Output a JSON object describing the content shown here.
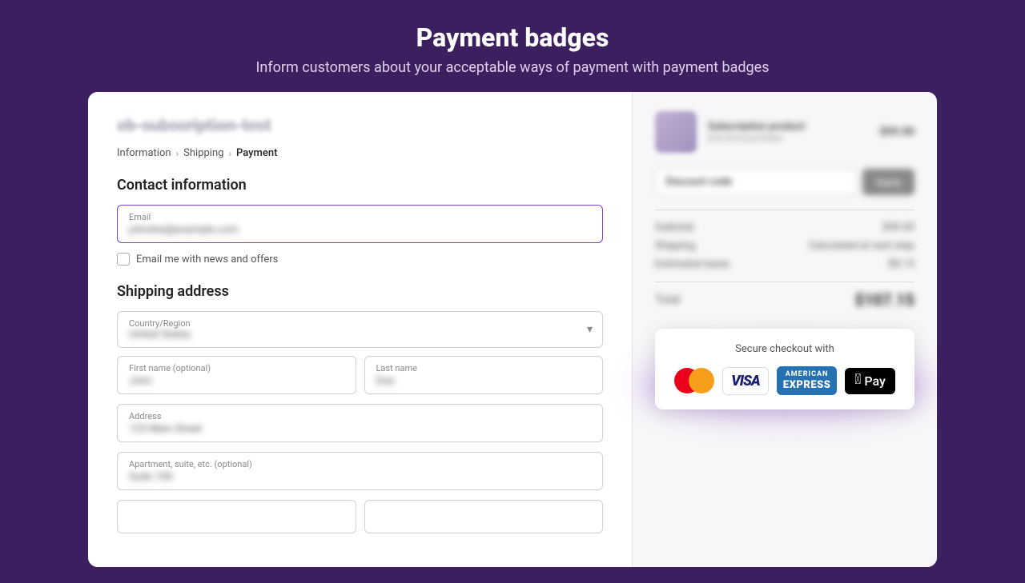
{
  "header": {
    "title": "Payment badges",
    "subtitle": "Inform customers about your acceptable ways of payment with payment badges"
  },
  "left_panel": {
    "store_name": "cb-subscription-test",
    "breadcrumb": {
      "information": "Information",
      "shipping": "Shipping",
      "payment": "Payment"
    },
    "contact_section": {
      "title": "Contact information",
      "email_label": "Email",
      "email_placeholder": "johndoe@example.com",
      "newsletter_label": "Email me with news and offers"
    },
    "shipping_section": {
      "title": "Shipping address",
      "country_label": "Country/Region",
      "country_value": "United States",
      "first_name_label": "First name (optional)",
      "first_name_value": "John",
      "last_name_label": "Last name",
      "last_name_value": "Doe",
      "address_label": "Address",
      "address_value": "123 Main Street",
      "apt_label": "Apartment, suite, etc. (optional)",
      "apt_value": "Suite 100"
    }
  },
  "right_panel": {
    "order_item": {
      "name": "Subscription product",
      "sub": "One-time purchase",
      "price": "$99.00"
    },
    "promo_placeholder": "Discount code",
    "promo_button": "Apply",
    "summary": {
      "subtotal_label": "Subtotal",
      "subtotal_value": "$99.00",
      "shipping_label": "Shipping",
      "shipping_value": "Calculated at next step",
      "estimated_label": "Estimated taxes",
      "estimated_value": "$8.15"
    },
    "total_label": "Total",
    "total_value": "$107.15",
    "payment_badges": {
      "secure_checkout_text": "Secure checkout with",
      "badges": [
        "mastercard",
        "visa",
        "amex",
        "apple-pay"
      ]
    }
  }
}
